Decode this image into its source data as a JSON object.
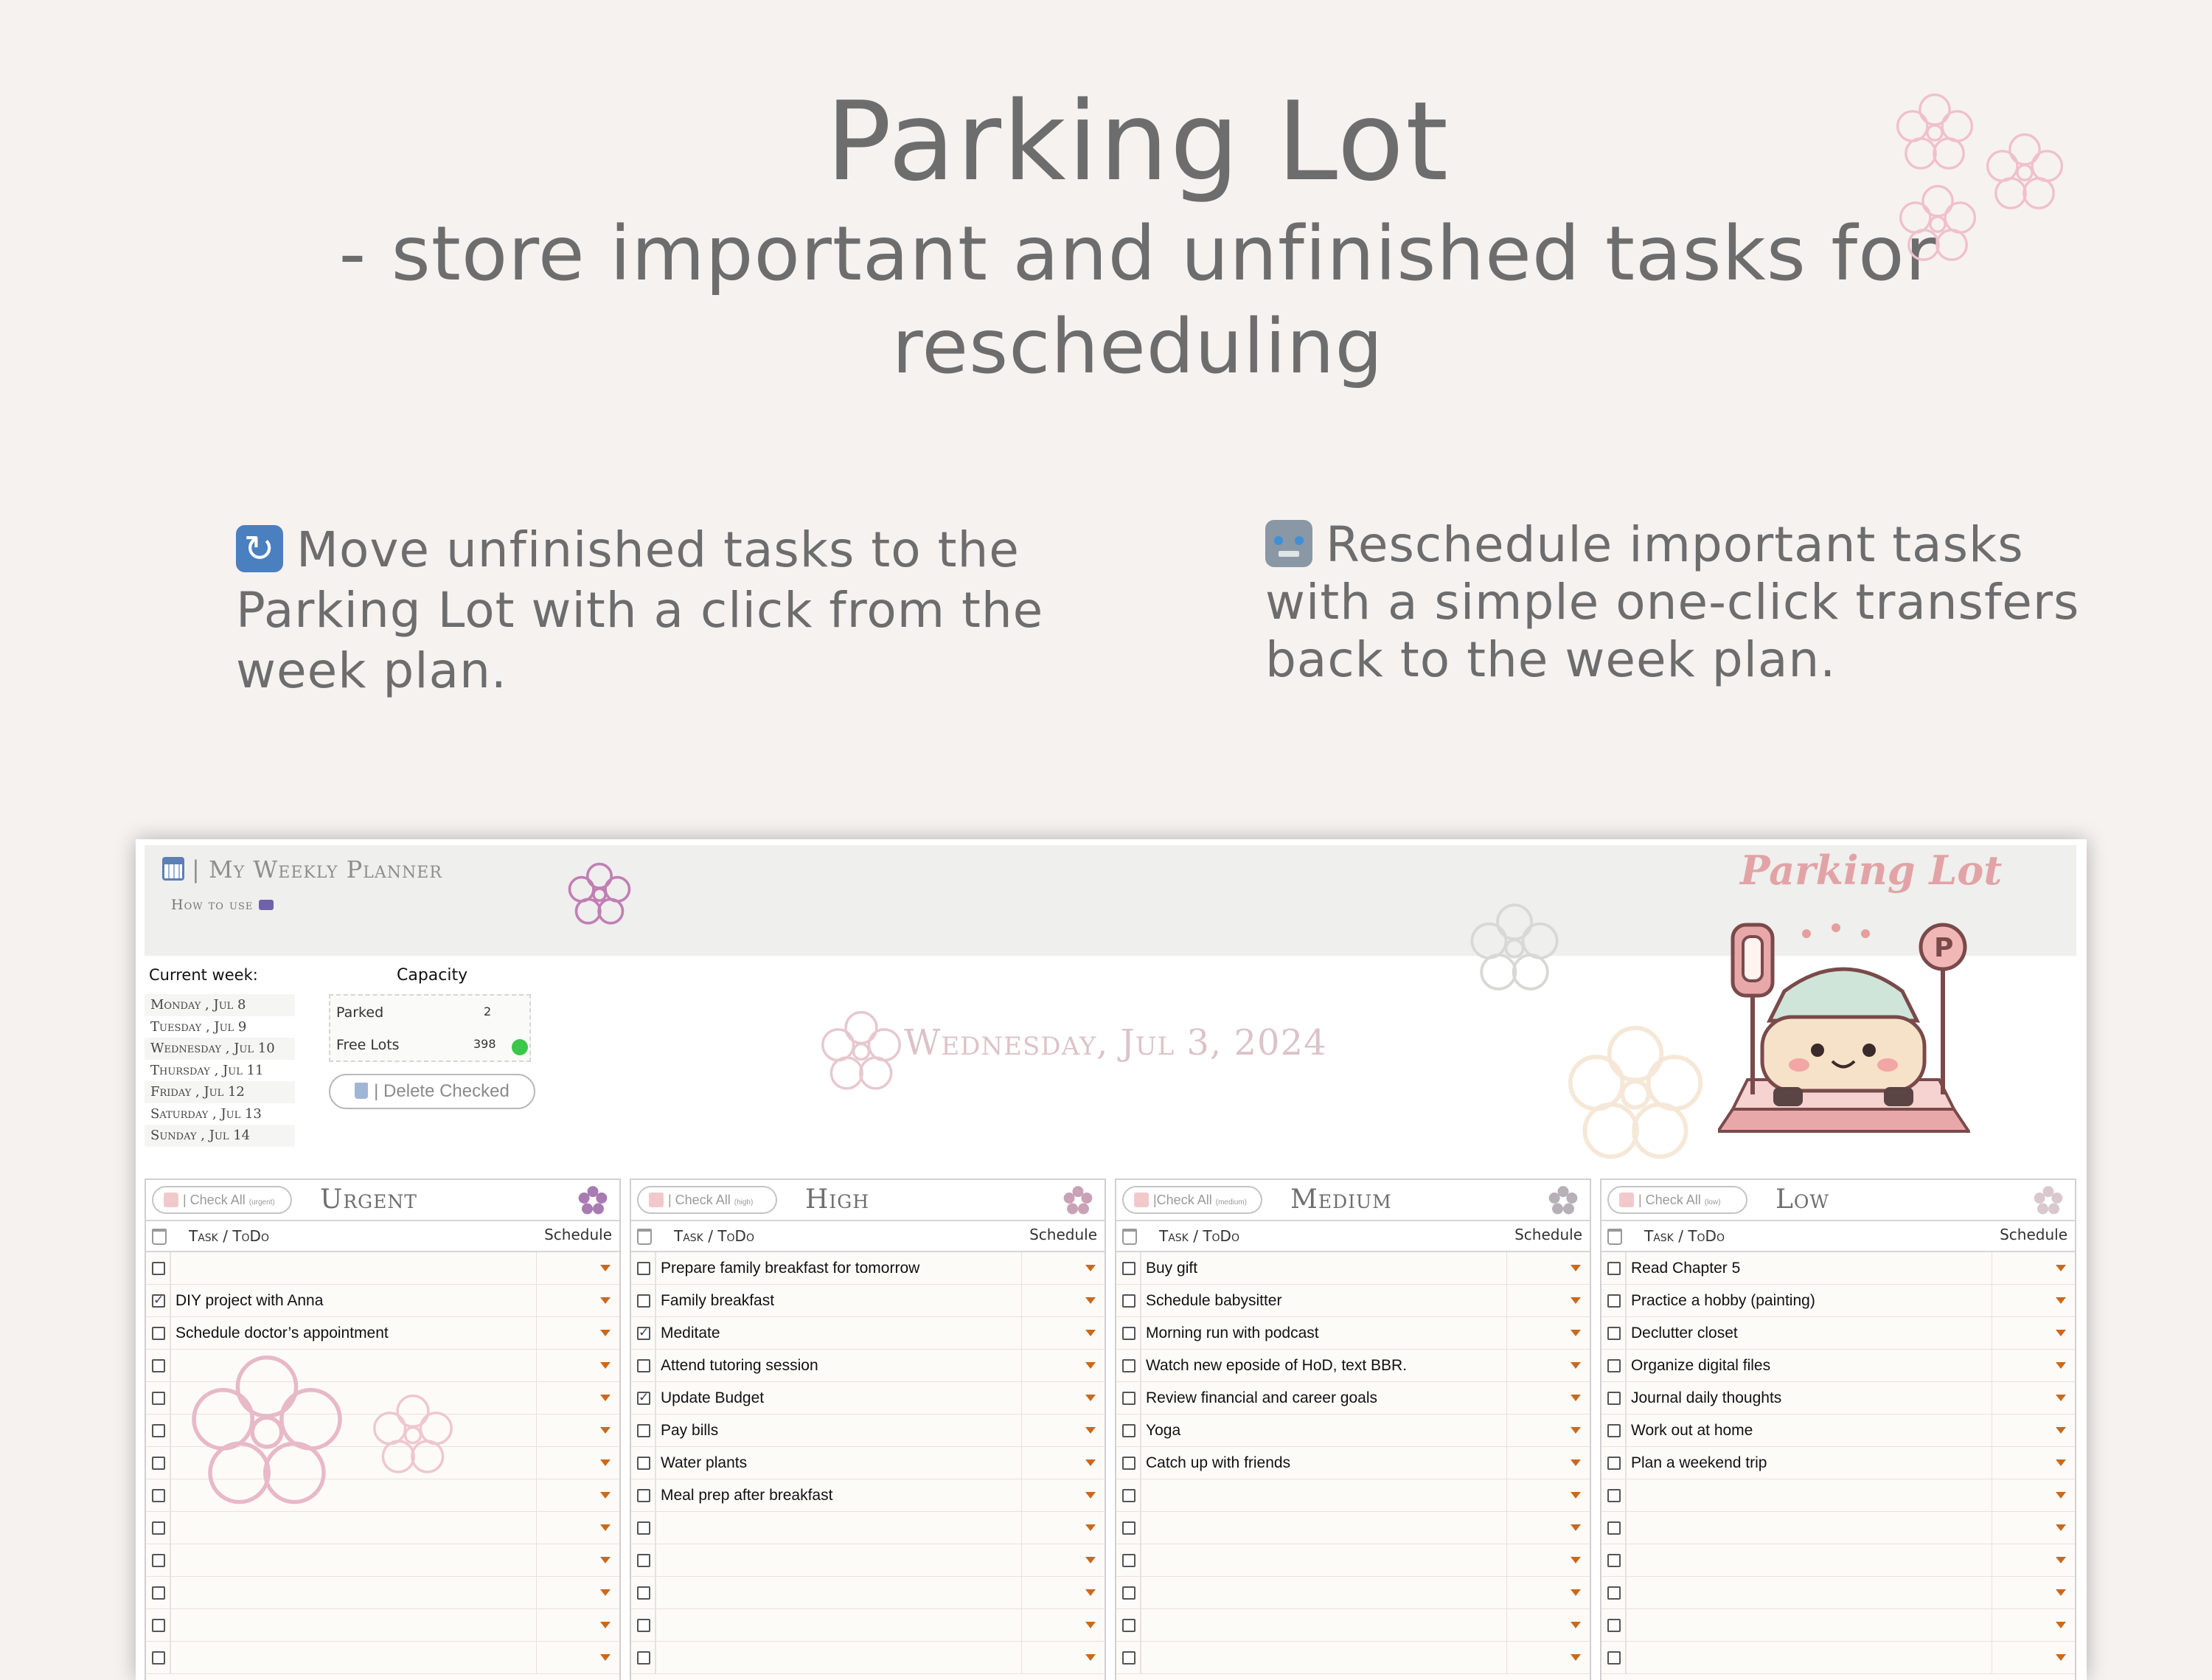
{
  "promo": {
    "title": "Parking Lot",
    "subtitle_line1": "- store important and unfinished tasks for",
    "subtitle_line2": "rescheduling",
    "feature_left": "Move unfinished tasks to the Parking Lot with a click from the week plan.",
    "feature_right": "Reschedule important tasks with a simple one-click transfers back to the week plan."
  },
  "app": {
    "title": "| My Weekly Planner",
    "how_to_use": "How to use",
    "logo": "Parking Lot",
    "current_week_label": "Current week:",
    "week_days": [
      "Monday , Jul 8",
      "Tuesday , Jul 9",
      "Wednesday , Jul 10",
      "Thursday , Jul 11",
      "Friday , Jul 12",
      "Saturday , Jul 13",
      "Sunday , Jul 14"
    ],
    "capacity": {
      "label": "Capacity",
      "parked_label": "Parked",
      "parked_value": "2",
      "free_label": "Free Lots",
      "free_value": "398",
      "status_color": "#3cc64a"
    },
    "delete_button": "| Delete Checked",
    "date": "Wednesday, Jul 3, 2024"
  },
  "columns": [
    {
      "title": "Urgent",
      "check_all": "| Check All",
      "check_all_tag": "(urgent)",
      "task_header": "Task / ToDo",
      "schedule_header": "Schedule",
      "flower_color": "#a87bb3",
      "rows": [
        {
          "text": "",
          "checked": false
        },
        {
          "text": "DIY project with Anna",
          "checked": true
        },
        {
          "text": "Schedule doctor’s appointment",
          "checked": false
        },
        {
          "text": "",
          "checked": false
        },
        {
          "text": "",
          "checked": false
        },
        {
          "text": "",
          "checked": false
        },
        {
          "text": "",
          "checked": false
        },
        {
          "text": "",
          "checked": false
        },
        {
          "text": "",
          "checked": false
        },
        {
          "text": "",
          "checked": false
        },
        {
          "text": "",
          "checked": false
        },
        {
          "text": "",
          "checked": false
        },
        {
          "text": "",
          "checked": false
        }
      ]
    },
    {
      "title": "High",
      "check_all": "| Check All",
      "check_all_tag": "(high)",
      "task_header": "Task / ToDo",
      "schedule_header": "Schedule",
      "flower_color": "#c9a2b6",
      "rows": [
        {
          "text": "Prepare family breakfast for tomorrow",
          "checked": false
        },
        {
          "text": "Family breakfast",
          "checked": false
        },
        {
          "text": "Meditate",
          "checked": true
        },
        {
          "text": "Attend tutoring session",
          "checked": false
        },
        {
          "text": "Update Budget",
          "checked": true
        },
        {
          "text": "Pay bills",
          "checked": false
        },
        {
          "text": "Water plants",
          "checked": false
        },
        {
          "text": "Meal prep after breakfast",
          "checked": false
        },
        {
          "text": "",
          "checked": false
        },
        {
          "text": "",
          "checked": false
        },
        {
          "text": "",
          "checked": false
        },
        {
          "text": "",
          "checked": false
        },
        {
          "text": "",
          "checked": false
        }
      ]
    },
    {
      "title": "Medium",
      "check_all": "|Check All",
      "check_all_tag": "(medium)",
      "task_header": "Task / ToDo",
      "schedule_header": "Schedule",
      "flower_color": "#b7b0b6",
      "rows": [
        {
          "text": "Buy gift",
          "checked": false
        },
        {
          "text": "Schedule babysitter",
          "checked": false
        },
        {
          "text": "Morning run with podcast",
          "checked": false
        },
        {
          "text": "Watch new eposide of HoD, text BBR.",
          "checked": false
        },
        {
          "text": "Review financial and career goals",
          "checked": false
        },
        {
          "text": "Yoga",
          "checked": false
        },
        {
          "text": "Catch up with friends",
          "checked": false
        },
        {
          "text": "",
          "checked": false
        },
        {
          "text": "",
          "checked": false
        },
        {
          "text": "",
          "checked": false
        },
        {
          "text": "",
          "checked": false
        },
        {
          "text": "",
          "checked": false
        },
        {
          "text": "",
          "checked": false
        }
      ]
    },
    {
      "title": "Low",
      "check_all": "| Check All",
      "check_all_tag": "(low)",
      "task_header": "Task / ToDo",
      "schedule_header": "Schedule",
      "flower_color": "#d9c9ce",
      "rows": [
        {
          "text": "Read Chapter 5",
          "checked": false
        },
        {
          "text": "Practice a hobby (painting)",
          "checked": false
        },
        {
          "text": "Declutter closet",
          "checked": false
        },
        {
          "text": "Organize digital files",
          "checked": false
        },
        {
          "text": "Journal daily thoughts",
          "checked": false
        },
        {
          "text": "Work out at home",
          "checked": false
        },
        {
          "text": "Plan a weekend trip",
          "checked": false
        },
        {
          "text": "",
          "checked": false
        },
        {
          "text": "",
          "checked": false
        },
        {
          "text": "",
          "checked": false
        },
        {
          "text": "",
          "checked": false
        },
        {
          "text": "",
          "checked": false
        },
        {
          "text": "",
          "checked": false
        }
      ]
    }
  ]
}
